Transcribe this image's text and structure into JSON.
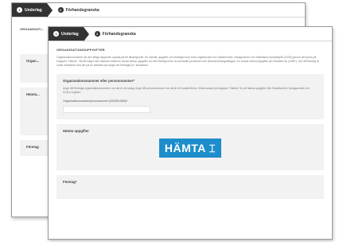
{
  "steps": [
    {
      "number": "1",
      "label": "Underlag",
      "active": true
    },
    {
      "number": "2",
      "label": "Förhandsgranska",
      "active": false
    }
  ],
  "back_window": {
    "section_title": "ORGANISATI...",
    "labels": [
      "Organ...",
      "Hämta...",
      "Företag"
    ]
  },
  "front_window": {
    "section_title": "ORGANISATIONSUPPGIFTER",
    "intro": "Organisationsnummer på den årliga rapporten sparas på ett lämpligt sätt. Du hämtar uppgifter om företaget som finns registrerade hos Skatteverket, Bolagsverket och Statistiska centralbyrån (SCB) genom att trycka på knappen \"Hämta\". Skulle något inte stämma måste du ändra dessa uppgifter om ditt företag innan du använder produkten och årsredovisningsbilagan. Du ändrar dessa uppgifter på verksamt.se (LÄNK). Om ditt företag är under likvidation ska det på en särskild rad anges att företaget är i likvidation.",
    "orgnr_panel": {
      "title": "Organisationsnummer eller personnummer*",
      "description": "Ange ditt företags organisationsnummer om det är ett bolag. Ange ditt personnummer om det är ett enskild firma. Klicka sedan på knappen \"Hämta\" för att hämta uppgifter från Skatteverket, Bolagsverket och SCB:s register.",
      "field_label": "Organisationsnummer/personnummer (000000-0000)*",
      "field_value": ""
    },
    "fetch_panel": {
      "title": "Hämta uppgifter",
      "button_label": "HÄMTA"
    },
    "company_panel": {
      "title": "Företag*"
    }
  }
}
